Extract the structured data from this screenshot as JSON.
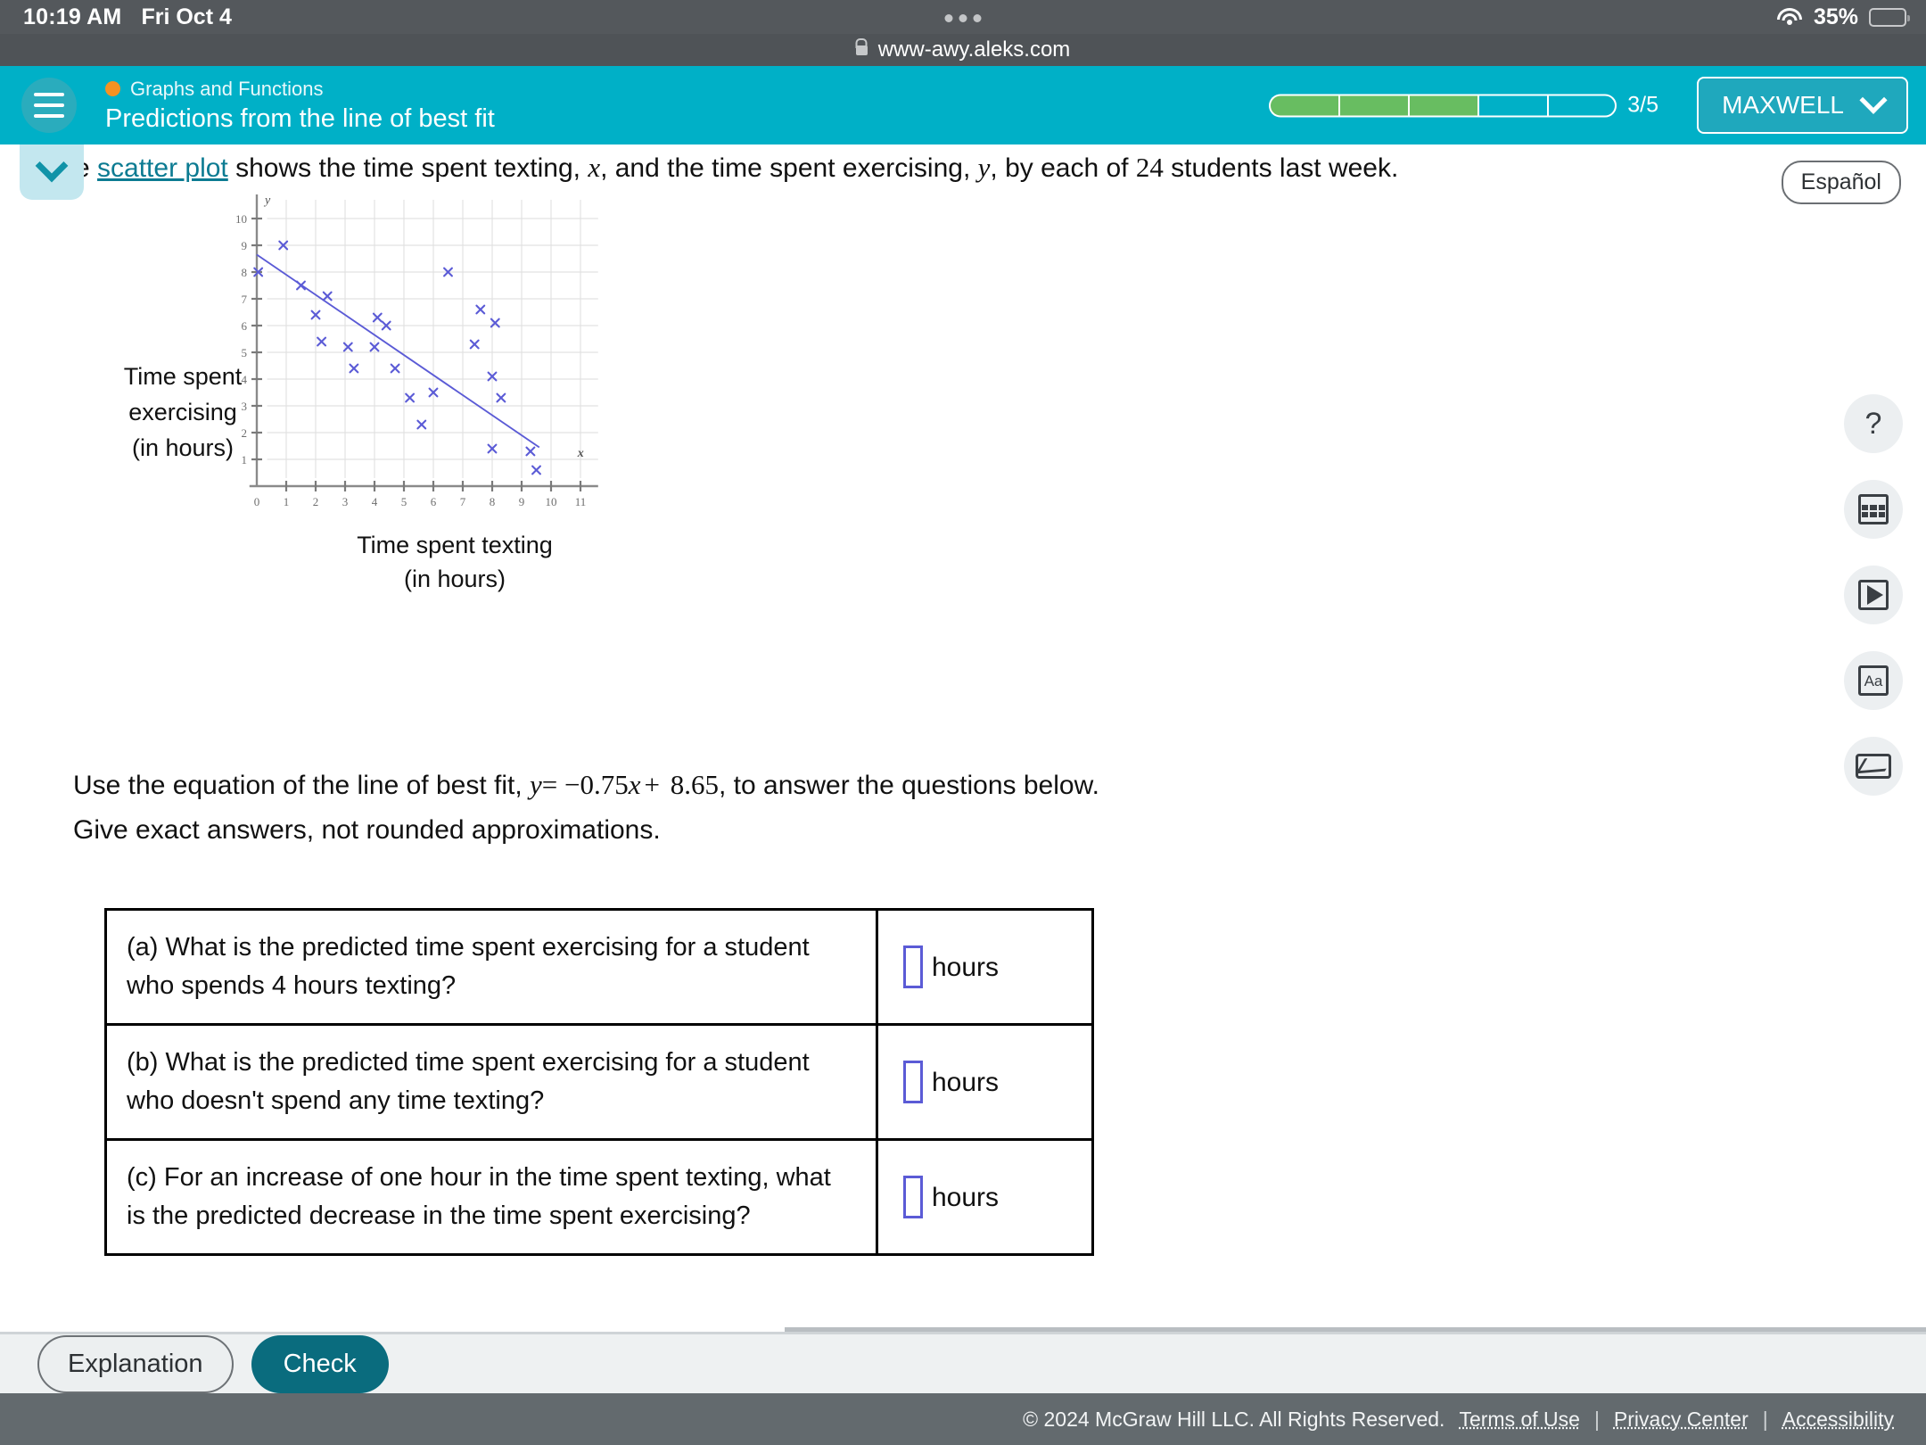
{
  "statusbar": {
    "time": "10:19 AM",
    "date": "Fri Oct 4",
    "battery_pct": "35%",
    "wifi_icon": "wifi-icon",
    "battery_icon": "battery-icon",
    "battery_color": "#f7ce46"
  },
  "browser": {
    "url": "www-awy.aleks.com",
    "lock_icon": "lock-icon"
  },
  "header": {
    "menu_icon": "hamburger-menu-icon",
    "topic": "Graphs and Functions",
    "topic_dot_color": "#f59222",
    "title": "Predictions from the line of best fit",
    "progress_label": "3/5",
    "progress_total": 5,
    "progress_filled": 3,
    "progress_fill_color": "#68bd61",
    "user_name": "MAXWELL",
    "user_chevron_icon": "chevron-down-icon",
    "accent_color": "#00b0c7"
  },
  "content": {
    "collapse_icon": "chevron-down-icon",
    "espanol_label": "Español",
    "question_prefix": "e ",
    "scatter_plot_link": "scatter plot",
    "question_mid1": " shows the time spent texting, ",
    "var_x": "x",
    "question_mid2": ", and the time spent exercising, ",
    "var_y": "y",
    "question_mid3": ", by each of ",
    "student_count": "24",
    "question_end": " students last week.",
    "equation_prefix": "Use the equation of the line of best fit, ",
    "equation_y": "y",
    "equation_eq": "= −",
    "equation_slope": "0.75",
    "equation_var": "x",
    "equation_plus": "+ ",
    "equation_intercept": "8.65",
    "equation_suffix": ", to answer the questions below.",
    "exact_note": "Give exact answers, not rounded approximations.",
    "rows": [
      {
        "question": "(a) What is the predicted time spent exercising for a student who spends 4 hours texting?",
        "answer_value": "",
        "unit": "hours"
      },
      {
        "question": "(b) What is the predicted time spent exercising for a student who doesn't spend any time texting?",
        "answer_value": "",
        "unit": "hours"
      },
      {
        "question": "(c) For an increase of one hour in the time spent texting, what is the predicted decrease in the time spent exercising?",
        "answer_value": "",
        "unit": "hours"
      }
    ]
  },
  "rail": {
    "help_icon": "question-mark-icon",
    "help_label": "?",
    "calculator_icon": "calculator-icon",
    "video_icon": "play-video-icon",
    "font_icon": "font-size-icon",
    "font_label": "Aa",
    "message_icon": "envelope-icon"
  },
  "actions": {
    "explanation_label": "Explanation",
    "check_label": "Check",
    "check_color": "#0a6c7e"
  },
  "footer": {
    "copyright": "© 2024 McGraw Hill LLC. All Rights Reserved.",
    "links": [
      "Terms of Use",
      "Privacy Center",
      "Accessibility"
    ]
  },
  "chart_data": {
    "type": "scatter",
    "title": "",
    "xlabel": "Time spent texting",
    "xlabel_unit": "(in hours)",
    "ylabel": "Time spent exercising",
    "ylabel_unit": "(in hours)",
    "axis_x_symbol": "x",
    "axis_y_symbol": "y",
    "xlim": [
      0,
      11.6
    ],
    "ylim": [
      0,
      10.6
    ],
    "xticks": [
      0,
      1,
      2,
      3,
      4,
      5,
      6,
      7,
      8,
      9,
      10,
      11
    ],
    "yticks": [
      1,
      2,
      3,
      4,
      5,
      6,
      7,
      8,
      9,
      10
    ],
    "grid": true,
    "marker": "x",
    "marker_color": "#5b5bd6",
    "n_points": 24,
    "points": [
      [
        0.05,
        8.0
      ],
      [
        0.9,
        9.0
      ],
      [
        1.5,
        7.5
      ],
      [
        2.0,
        6.4
      ],
      [
        2.4,
        7.1
      ],
      [
        2.2,
        5.4
      ],
      [
        3.1,
        5.2
      ],
      [
        3.3,
        4.4
      ],
      [
        4.1,
        6.3
      ],
      [
        4.4,
        6.0
      ],
      [
        4.0,
        5.2
      ],
      [
        4.7,
        4.4
      ],
      [
        5.2,
        3.3
      ],
      [
        6.0,
        3.5
      ],
      [
        5.6,
        2.3
      ],
      [
        6.5,
        8.0
      ],
      [
        7.6,
        6.6
      ],
      [
        8.1,
        6.1
      ],
      [
        7.4,
        5.3
      ],
      [
        8.0,
        4.1
      ],
      [
        8.3,
        3.3
      ],
      [
        8.0,
        1.4
      ],
      [
        9.3,
        1.3
      ],
      [
        9.5,
        0.6
      ]
    ],
    "line_of_best_fit": {
      "slope": -0.75,
      "intercept": 8.65,
      "x_start": 0.0,
      "x_end": 9.6,
      "color": "#5b5bd6",
      "equation": "y = -0.75x + 8.65"
    }
  }
}
